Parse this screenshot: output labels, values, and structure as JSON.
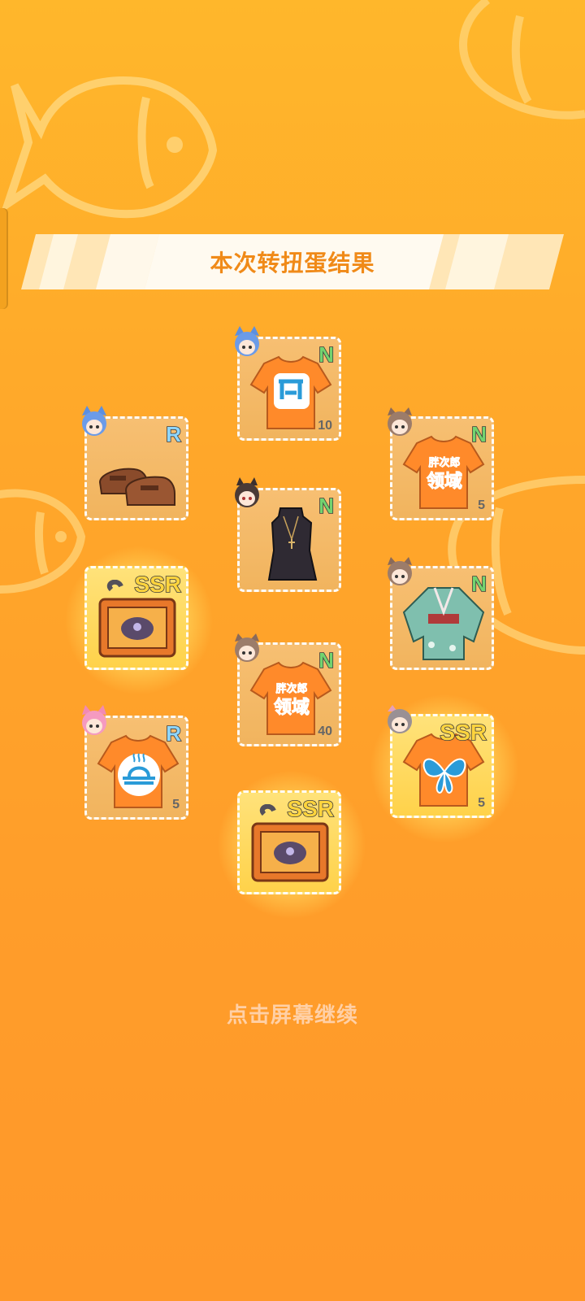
{
  "title": "本次转扭蛋结果",
  "continue_hint": "点击屏幕继续",
  "colors": {
    "background": "#ffa72a",
    "title_text": "#f08a18",
    "hint_text": "#ffd0a6",
    "rarity_n": "#73d36f",
    "rarity_r": "#8fd7ff",
    "rarity_ssr": "#ffd43d"
  },
  "items": [
    {
      "id": "tshirt-1",
      "rarity": "N",
      "count": "10",
      "art": "orange-tshirt-icon",
      "avatar": "blue-cat-girl-avatar"
    },
    {
      "id": "shoes",
      "rarity": "R",
      "count": "",
      "art": "brown-loafers-icon",
      "avatar": "blue-cat-girl-avatar"
    },
    {
      "id": "tshirt-2",
      "rarity": "N",
      "count": "5",
      "art": "orange-tshirt-icon",
      "avatar": "brown-hair-girl-avatar"
    },
    {
      "id": "dress",
      "rarity": "N",
      "count": "",
      "art": "black-dress-icon",
      "avatar": "dark-hair-girl-avatar"
    },
    {
      "id": "chest-1",
      "rarity": "SSR",
      "count": "",
      "art": "ssr-chest-icon",
      "avatar": ""
    },
    {
      "id": "kimono",
      "rarity": "N",
      "count": "",
      "art": "green-kimono-icon",
      "avatar": "brown-hair-girl-avatar"
    },
    {
      "id": "tshirt-3",
      "rarity": "N",
      "count": "40",
      "art": "orange-tshirt-icon",
      "avatar": "brown-hair-girl-avatar"
    },
    {
      "id": "tshirt-4",
      "rarity": "R",
      "count": "5",
      "art": "orange-tshirt-icon",
      "avatar": "pink-hair-girl-avatar"
    },
    {
      "id": "tshirt-5",
      "rarity": "SSR",
      "count": "5",
      "art": "orange-tshirt-icon",
      "avatar": "gray-hair-girl-avatar"
    },
    {
      "id": "chest-2",
      "rarity": "SSR",
      "count": "",
      "art": "ssr-chest-icon",
      "avatar": ""
    }
  ],
  "shirt_prints": {
    "tshirt-2": [
      "胖次郎",
      "领域"
    ],
    "tshirt-3": [
      "胖次郎",
      "领域"
    ]
  }
}
